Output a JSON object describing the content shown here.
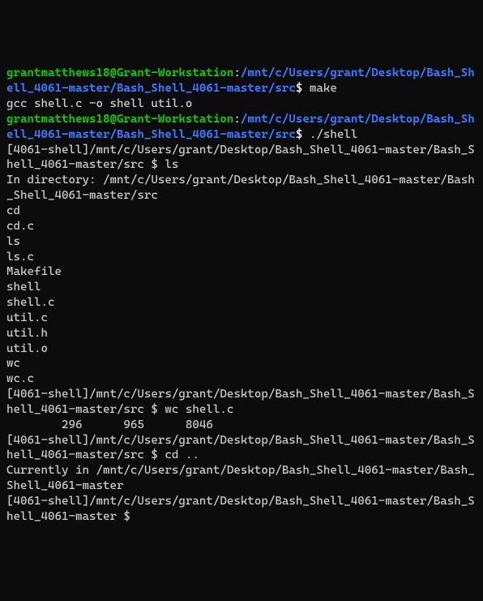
{
  "prompt1": {
    "user_host": "grantmatthews18@Grant-Workstation",
    "colon": ":",
    "path": "/mnt/c/Users/grant/Desktop/Bash_Shell_4061-master/Bash_Shell_4061-master/src",
    "dollar": "$ ",
    "command": "make"
  },
  "make_output": "gcc shell.c -o shell util.o",
  "prompt2": {
    "user_host": "grantmatthews18@Grant-Workstation",
    "colon": ":",
    "path": "/mnt/c/Users/grant/Desktop/Bash_Shell_4061-master/Bash_Shell_4061-master/src",
    "dollar": "$ ",
    "command": "./shell"
  },
  "shell_prompt1": "[4061-shell]/mnt/c/Users/grant/Desktop/Bash_Shell_4061-master/Bash_Shell_4061-master/src $ ",
  "shell_cmd1": "ls",
  "ls_header": "In directory: /mnt/c/Users/grant/Desktop/Bash_Shell_4061-master/Bash_Shell_4061-master/src",
  "ls_items": [
    "cd",
    "cd.c",
    "ls",
    "ls.c",
    "Makefile",
    "shell",
    "shell.c",
    "util.c",
    "util.h",
    "util.o",
    "wc",
    "wc.c"
  ],
  "shell_prompt2": "[4061-shell]/mnt/c/Users/grant/Desktop/Bash_Shell_4061-master/Bash_Shell_4061-master/src $ ",
  "shell_cmd2": "wc shell.c",
  "wc_output": "        296      965      8046",
  "shell_prompt3": "[4061-shell]/mnt/c/Users/grant/Desktop/Bash_Shell_4061-master/Bash_Shell_4061-master/src $ ",
  "shell_cmd3": "cd ..",
  "cd_output": "Currently in /mnt/c/Users/grant/Desktop/Bash_Shell_4061-master/Bash_Shell_4061-master",
  "shell_prompt4": "[4061-shell]/mnt/c/Users/grant/Desktop/Bash_Shell_4061-master/Bash_Shell_4061-master $ "
}
